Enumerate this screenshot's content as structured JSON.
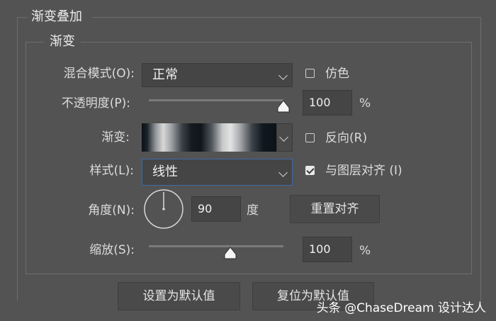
{
  "section_title": "渐变叠加",
  "group_title": "渐变",
  "blend_mode": {
    "label": "混合模式(O):",
    "value": "正常"
  },
  "dither": {
    "label": "仿色",
    "checked": false
  },
  "opacity": {
    "label": "不透明度(P):",
    "value": "100",
    "unit": "%",
    "level_percent": 100
  },
  "gradient": {
    "label": "渐变:"
  },
  "reverse": {
    "label": "反向(R)",
    "checked": false
  },
  "style": {
    "label": "样式(L):",
    "value": "线性"
  },
  "align_with_layer": {
    "label": "与图层对齐 (I)",
    "checked": true
  },
  "angle": {
    "label": "角度(N):",
    "value": "90",
    "unit": "度"
  },
  "reset_align_button": "重置对齐",
  "scale": {
    "label": "缩放(S):",
    "value": "100",
    "unit": "%",
    "level_percent": 100
  },
  "set_default_button": "设置为默认值",
  "reset_default_button": "复位为默认值",
  "watermark": "头条 @ChaseDream 设计达人"
}
